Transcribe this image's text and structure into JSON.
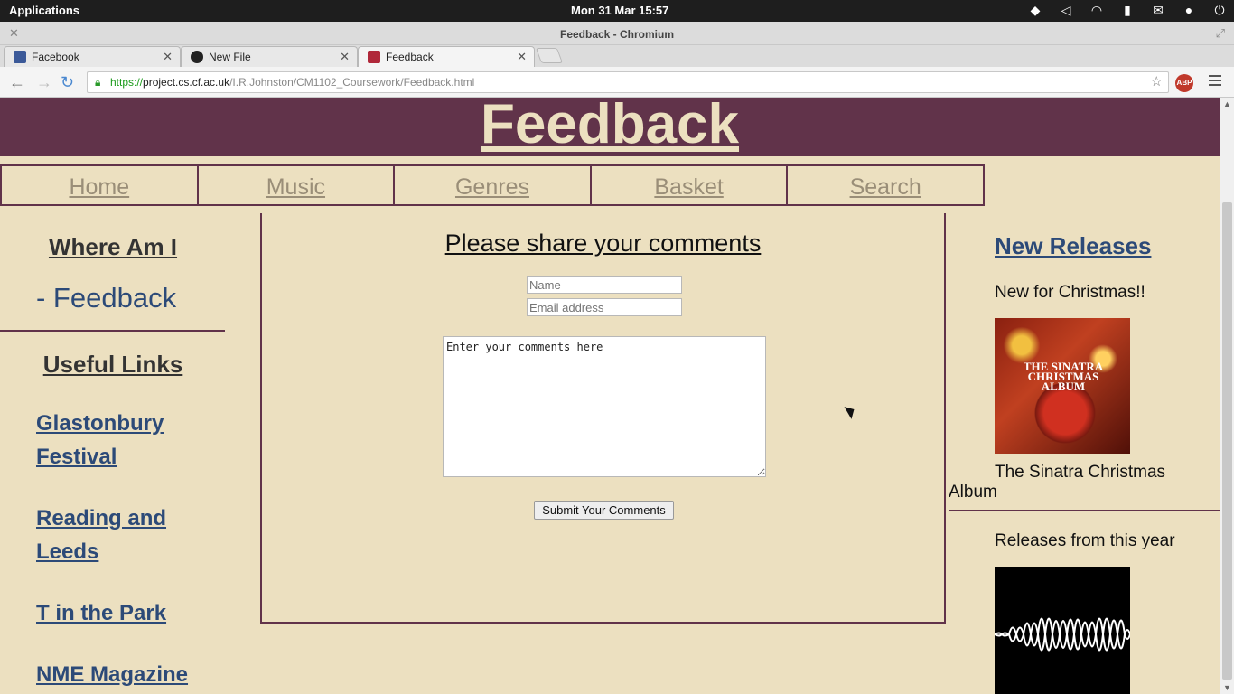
{
  "system_bar": {
    "applications": "Applications",
    "clock": "Mon 31 Mar 15:57"
  },
  "window": {
    "title": "Feedback - Chromium"
  },
  "tabs": [
    {
      "label": "Facebook",
      "icon": "facebook-icon"
    },
    {
      "label": "New File",
      "icon": "github-icon"
    },
    {
      "label": "Feedback",
      "icon": "cscs-icon"
    }
  ],
  "address_bar": {
    "scheme": "https://",
    "host": "project.cs.cf.ac.uk",
    "path": "/I.R.Johnston/CM1102_Coursework/Feedback.html"
  },
  "extensions": {
    "adblock": "ABP"
  },
  "page": {
    "banner_title": "Feedback",
    "nav": [
      "Home",
      "Music",
      "Genres",
      "Basket",
      "Search"
    ],
    "where_am_i_heading": "Where Am I",
    "location": "- Feedback",
    "useful_links_heading": "Useful Links",
    "useful_links": [
      "Glastonbury Festival",
      "Reading and Leeds",
      "T in the Park",
      "NME Magazine"
    ],
    "form": {
      "heading": "Please share your comments",
      "name_placeholder": "Name",
      "email_placeholder": "Email address",
      "comments_value": "Enter your comments here",
      "submit_label": "Submit Your Comments"
    },
    "new_releases": {
      "heading": "New Releases",
      "subtitle": "New for Christmas!!",
      "album_art_text": "THE SINATRA CHRISTMAS ALBUM",
      "album_caption_line1": "The Sinatra Christmas",
      "album_caption_line2": "Album",
      "year_heading": "Releases from this year"
    }
  },
  "colors": {
    "page_background": "#ece0c0",
    "banner": "#61334a",
    "link": "#2c4a78",
    "nav_text": "#9a8e78"
  }
}
